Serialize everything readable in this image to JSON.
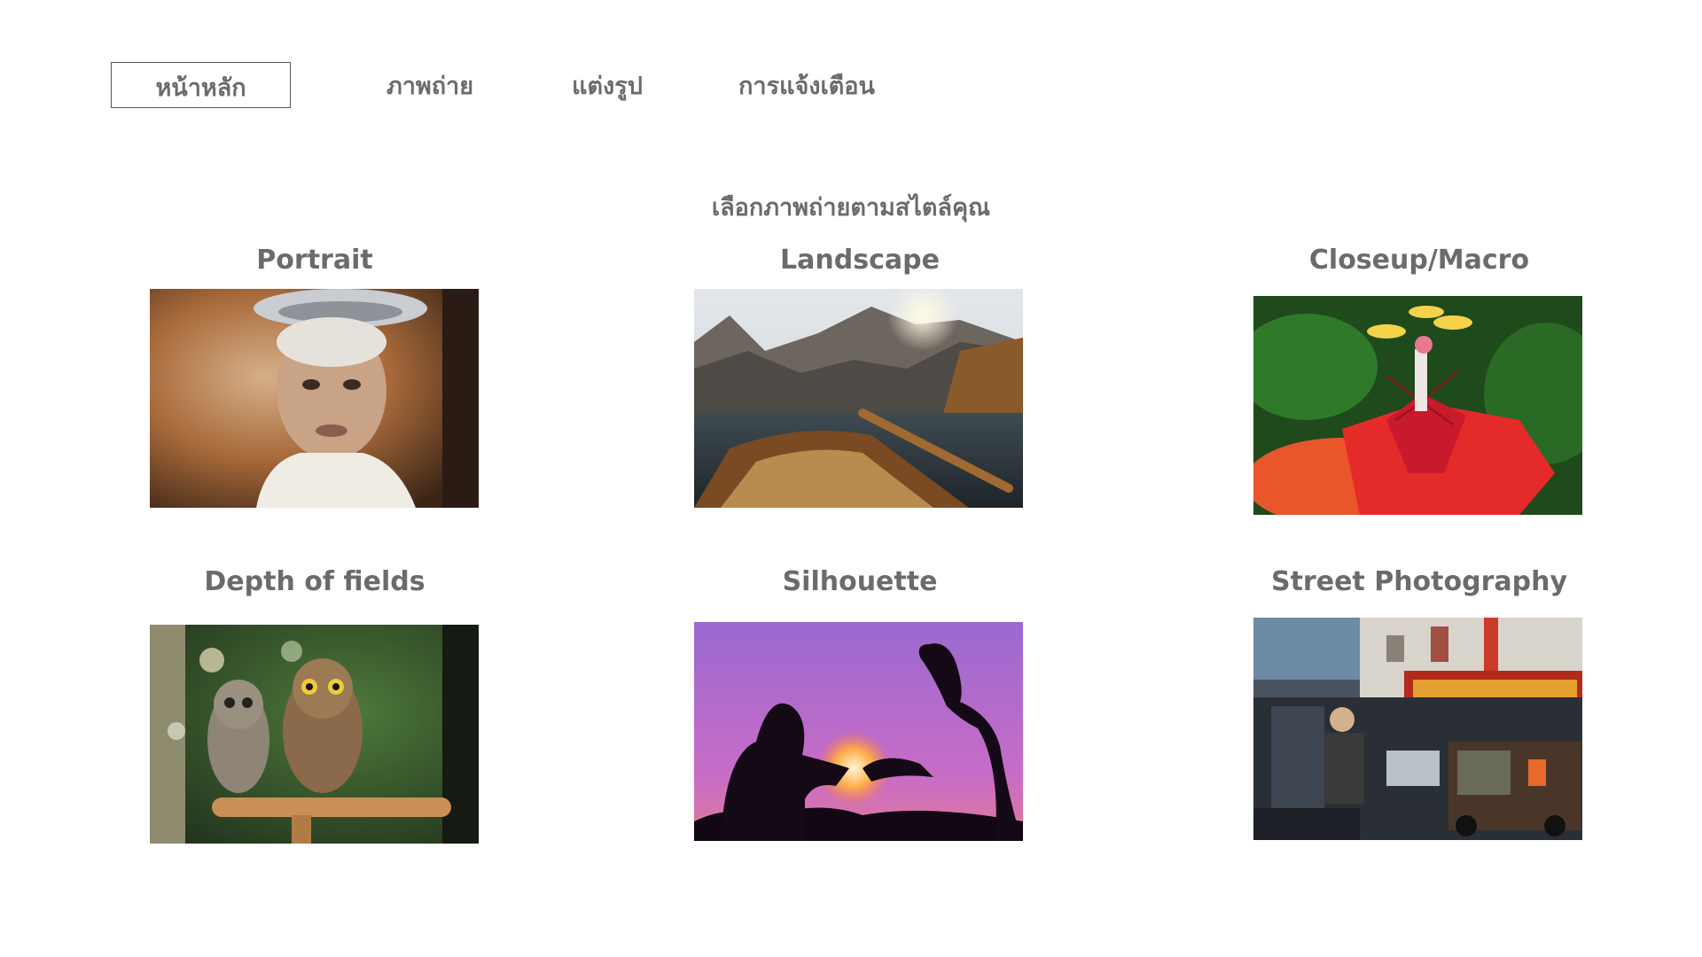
{
  "nav": {
    "items": [
      {
        "label": "หน้าหลัก",
        "active": true
      },
      {
        "label": "ภาพถ่าย",
        "active": false
      },
      {
        "label": "แต่งรูป",
        "active": false
      },
      {
        "label": "การแจ้งเตือน",
        "active": false
      }
    ]
  },
  "main": {
    "subtitle": "เลือกภาพถ่ายตามสไตล์คุณ",
    "categories": [
      {
        "title": "Portrait",
        "image": "elderly-woman-portrait-photo"
      },
      {
        "title": "Landscape",
        "image": "mountain-lake-boat-photo"
      },
      {
        "title": "Closeup/Macro",
        "image": "red-passion-flower-photo"
      },
      {
        "title": "Depth of fields",
        "image": "owls-on-perch-photo"
      },
      {
        "title": "Silhouette",
        "image": "couple-heart-hands-silhouette-photo"
      },
      {
        "title": "Street Photography",
        "image": "chinatown-street-photo"
      }
    ]
  },
  "colors": {
    "text": "#6b6b6b",
    "border": "#555555",
    "background": "#ffffff"
  }
}
